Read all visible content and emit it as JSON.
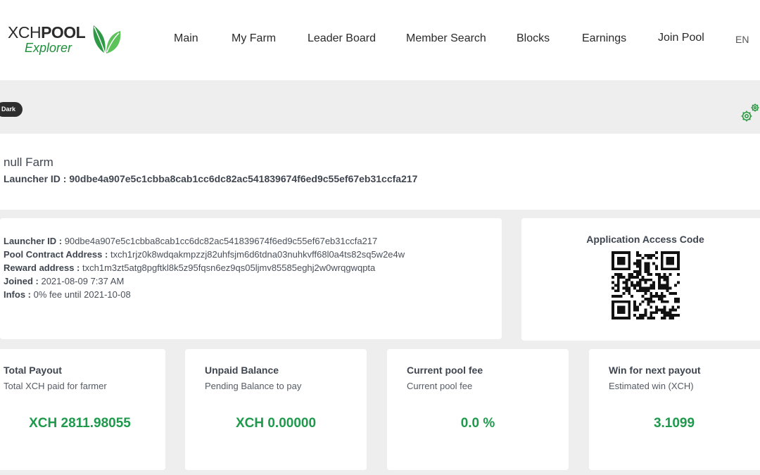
{
  "logo": {
    "text_prefix": "XCH",
    "text_bold": "POOL",
    "subtitle": "Explorer"
  },
  "nav": {
    "items": [
      "Main",
      "My Farm",
      "Leader Board",
      "Member Search",
      "Blocks",
      "Earnings",
      "Join Pool"
    ],
    "language": "EN"
  },
  "settings": {
    "theme_toggle": "Dark"
  },
  "farm": {
    "name": "null Farm",
    "launcher_label": "Launcher ID :",
    "launcher_id": "90dbe4a907e5c1cbba8cab1cc6dc82ac541839674f6ed9c55ef67eb31ccfa217"
  },
  "info": {
    "rows": [
      {
        "label": "Launcher ID :",
        "value": "90dbe4a907e5c1cbba8cab1cc6dc82ac541839674f6ed9c55ef67eb31ccfa217"
      },
      {
        "label": "Pool Contract Address :",
        "value": "txch1rjz0k8wdqakmpzzj82uhfsjm6d6tdna03nuhkvff68l0a4ts82sq5w2e4w"
      },
      {
        "label": "Reward address :",
        "value": "txch1m3zt5atg8pgftkl8k5z95fqsn6ez9qs05ljmv85585eghj2w0wrqgwqpta"
      },
      {
        "label": "Joined :",
        "value": "2021-08-09 7:37 AM"
      },
      {
        "label": "Infos :",
        "value": "0% fee until 2021-10-08"
      }
    ]
  },
  "qr": {
    "title": "Application Access Code"
  },
  "stats": [
    {
      "title": "Total Payout",
      "subtitle": "Total XCH paid for farmer",
      "value": "XCH 2811.98055"
    },
    {
      "title": "Unpaid Balance",
      "subtitle": "Pending Balance to pay",
      "value": "XCH 0.00000"
    },
    {
      "title": "Current pool fee",
      "subtitle": "Current pool fee",
      "value": "0.0 %"
    },
    {
      "title": "Win for next payout",
      "subtitle": "Estimated win (XCH)",
      "value": "3.1099"
    }
  ],
  "colors": {
    "accent": "#1f9a4d",
    "header_bg": "#ffffff",
    "page_bg": "#eeeeee",
    "toggle_bg": "#2e2e2e"
  }
}
